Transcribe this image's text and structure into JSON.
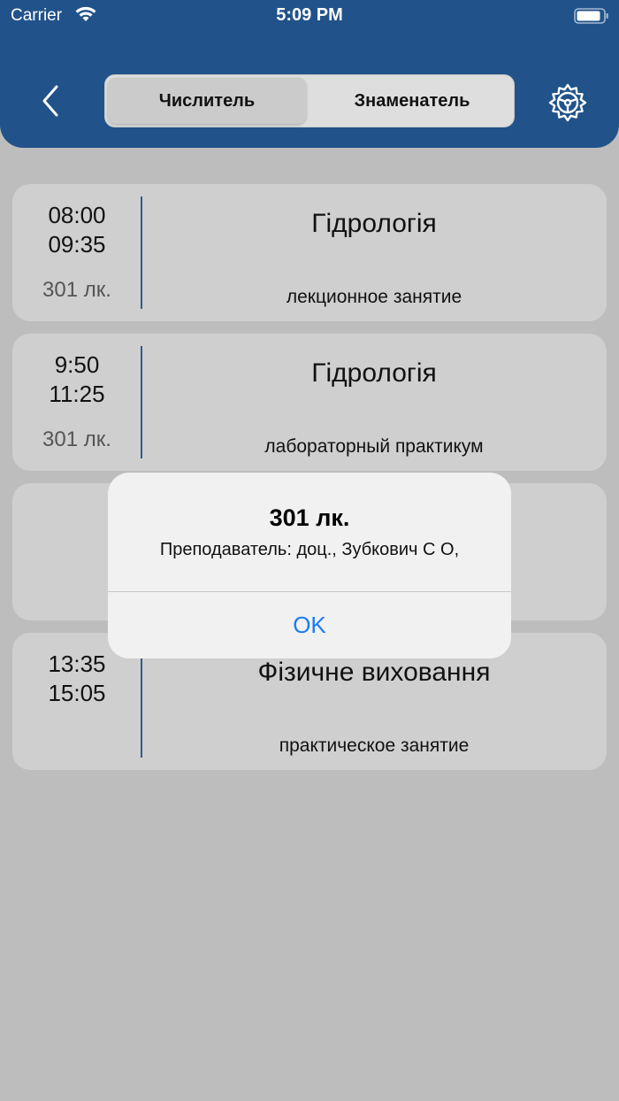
{
  "status_bar": {
    "carrier": "Carrier",
    "time": "5:09 PM"
  },
  "header": {
    "segments": [
      "Числитель",
      "Знаменатель"
    ],
    "selected_segment": "Числитель",
    "colors": {
      "header_bg": "#21538a"
    }
  },
  "lessons": [
    {
      "start": "08:00",
      "end": "09:35",
      "room": "301 лк.",
      "subject": "Гідрологія",
      "type": "лекционное занятие"
    },
    {
      "start": "9:50",
      "end": "11:25",
      "room": "301 лк.",
      "subject": "Гідрологія",
      "type": "лабораторный практикум"
    },
    {
      "start": "",
      "end": "",
      "room": "",
      "subject": "",
      "type": ""
    },
    {
      "start": "13:35",
      "end": "15:05",
      "room": "",
      "subject": "Фізичне виховання",
      "type": "практическое занятие"
    }
  ],
  "alert": {
    "title": "301 лк.",
    "message": "Преподаватель: доц., Зубкович С О,",
    "ok_label": "OK",
    "ok_color": "#1b7cf0"
  }
}
